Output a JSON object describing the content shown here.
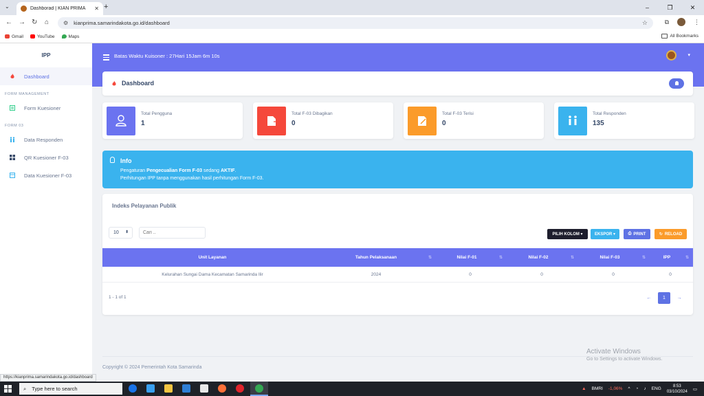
{
  "browser": {
    "tab_title": "Dashborad | KIAN PRIMA",
    "tab_close": "✕",
    "new_tab": "+",
    "tab_menu": "⌄",
    "window_controls": {
      "minimize": "–",
      "restore": "❐",
      "close": "✕"
    },
    "url": "kianprima.samarindakota.go.id/dashboard",
    "nav": {
      "back": "←",
      "forward": "→",
      "reload": "↻",
      "home": "⌂"
    },
    "bookmarks": [
      "Gmail",
      "YouTube",
      "Maps"
    ],
    "all_bookmarks": "All Bookmarks",
    "status_url": "https://kianprima.samarindakota.go.id/dashboard"
  },
  "sidebar": {
    "brand": "IPP",
    "items": [
      {
        "label": "Dashboard",
        "icon": "flame-icon"
      },
      {
        "section": "FORM MANAGEMENT"
      },
      {
        "label": "Form Kuesioner",
        "icon": "form-icon"
      },
      {
        "section": "FORM 03"
      },
      {
        "label": "Data Responden",
        "icon": "users-icon"
      },
      {
        "label": "QR Kuesioner F-03",
        "icon": "qr-icon"
      },
      {
        "label": "Data Kuesioner F-03",
        "icon": "data-icon"
      }
    ]
  },
  "header": {
    "deadline": "Batas Waktu Kuisoner : 27Hari 15Jam 6m 10s",
    "user_caret": "▾"
  },
  "dashboard": {
    "title": "Dashboard"
  },
  "stats": [
    {
      "label": "Total Pengguna",
      "value": "1",
      "color": "#6b73f0"
    },
    {
      "label": "Total F-03 Dibagikan",
      "value": "0",
      "color": "#f5483b"
    },
    {
      "label": "Total F-03 Terisi",
      "value": "0",
      "color": "#fb9b2a"
    },
    {
      "label": "Total Responden",
      "value": "135",
      "color": "#3ab3ee"
    }
  ],
  "info": {
    "title": "Info",
    "line1_pre": "Pengaturan ",
    "line1_bold1": "Pengecualian Form F-03",
    "line1_mid": " sedang ",
    "line1_bold2": "AKTIF",
    "line1_post": ".",
    "line2": "Perhitungan IPP tanpa menggunakan hasil perhitungan Form F-03."
  },
  "table": {
    "title": "Indeks Pelayanan Publik",
    "page_size": "10",
    "search_placeholder": "Cari ..",
    "buttons": {
      "kolom": "PILIH KOLOM ▾",
      "ekspor": "EKSPOR ▾",
      "print": "PRINT",
      "reload": "RELOAD"
    },
    "columns": [
      "Unit Layanan",
      "Tahun Pelaksanaan",
      "Nilai F-01",
      "Nilai F-02",
      "Nilai F-03",
      "IPP"
    ],
    "rows": [
      [
        "Kelurahan Sungai Dama Kecamatan Samarinda Ilir",
        "2024",
        "0",
        "0",
        "0",
        "0"
      ]
    ],
    "page_info": "1 - 1 of 1",
    "pagination": {
      "prev": "←",
      "current": "1",
      "next": "→"
    }
  },
  "footer": {
    "copyright": "Copyright © 2024 Pemerintah Kota Samarinda"
  },
  "watermark": {
    "line1": "Activate Windows",
    "line2": "Go to Settings to activate Windows."
  },
  "taskbar": {
    "search": "Type here to search",
    "stock_name": "BMRI",
    "stock_change": "-1,06%",
    "lang": "ENG",
    "time": "8:53",
    "date": "03/10/2024"
  }
}
